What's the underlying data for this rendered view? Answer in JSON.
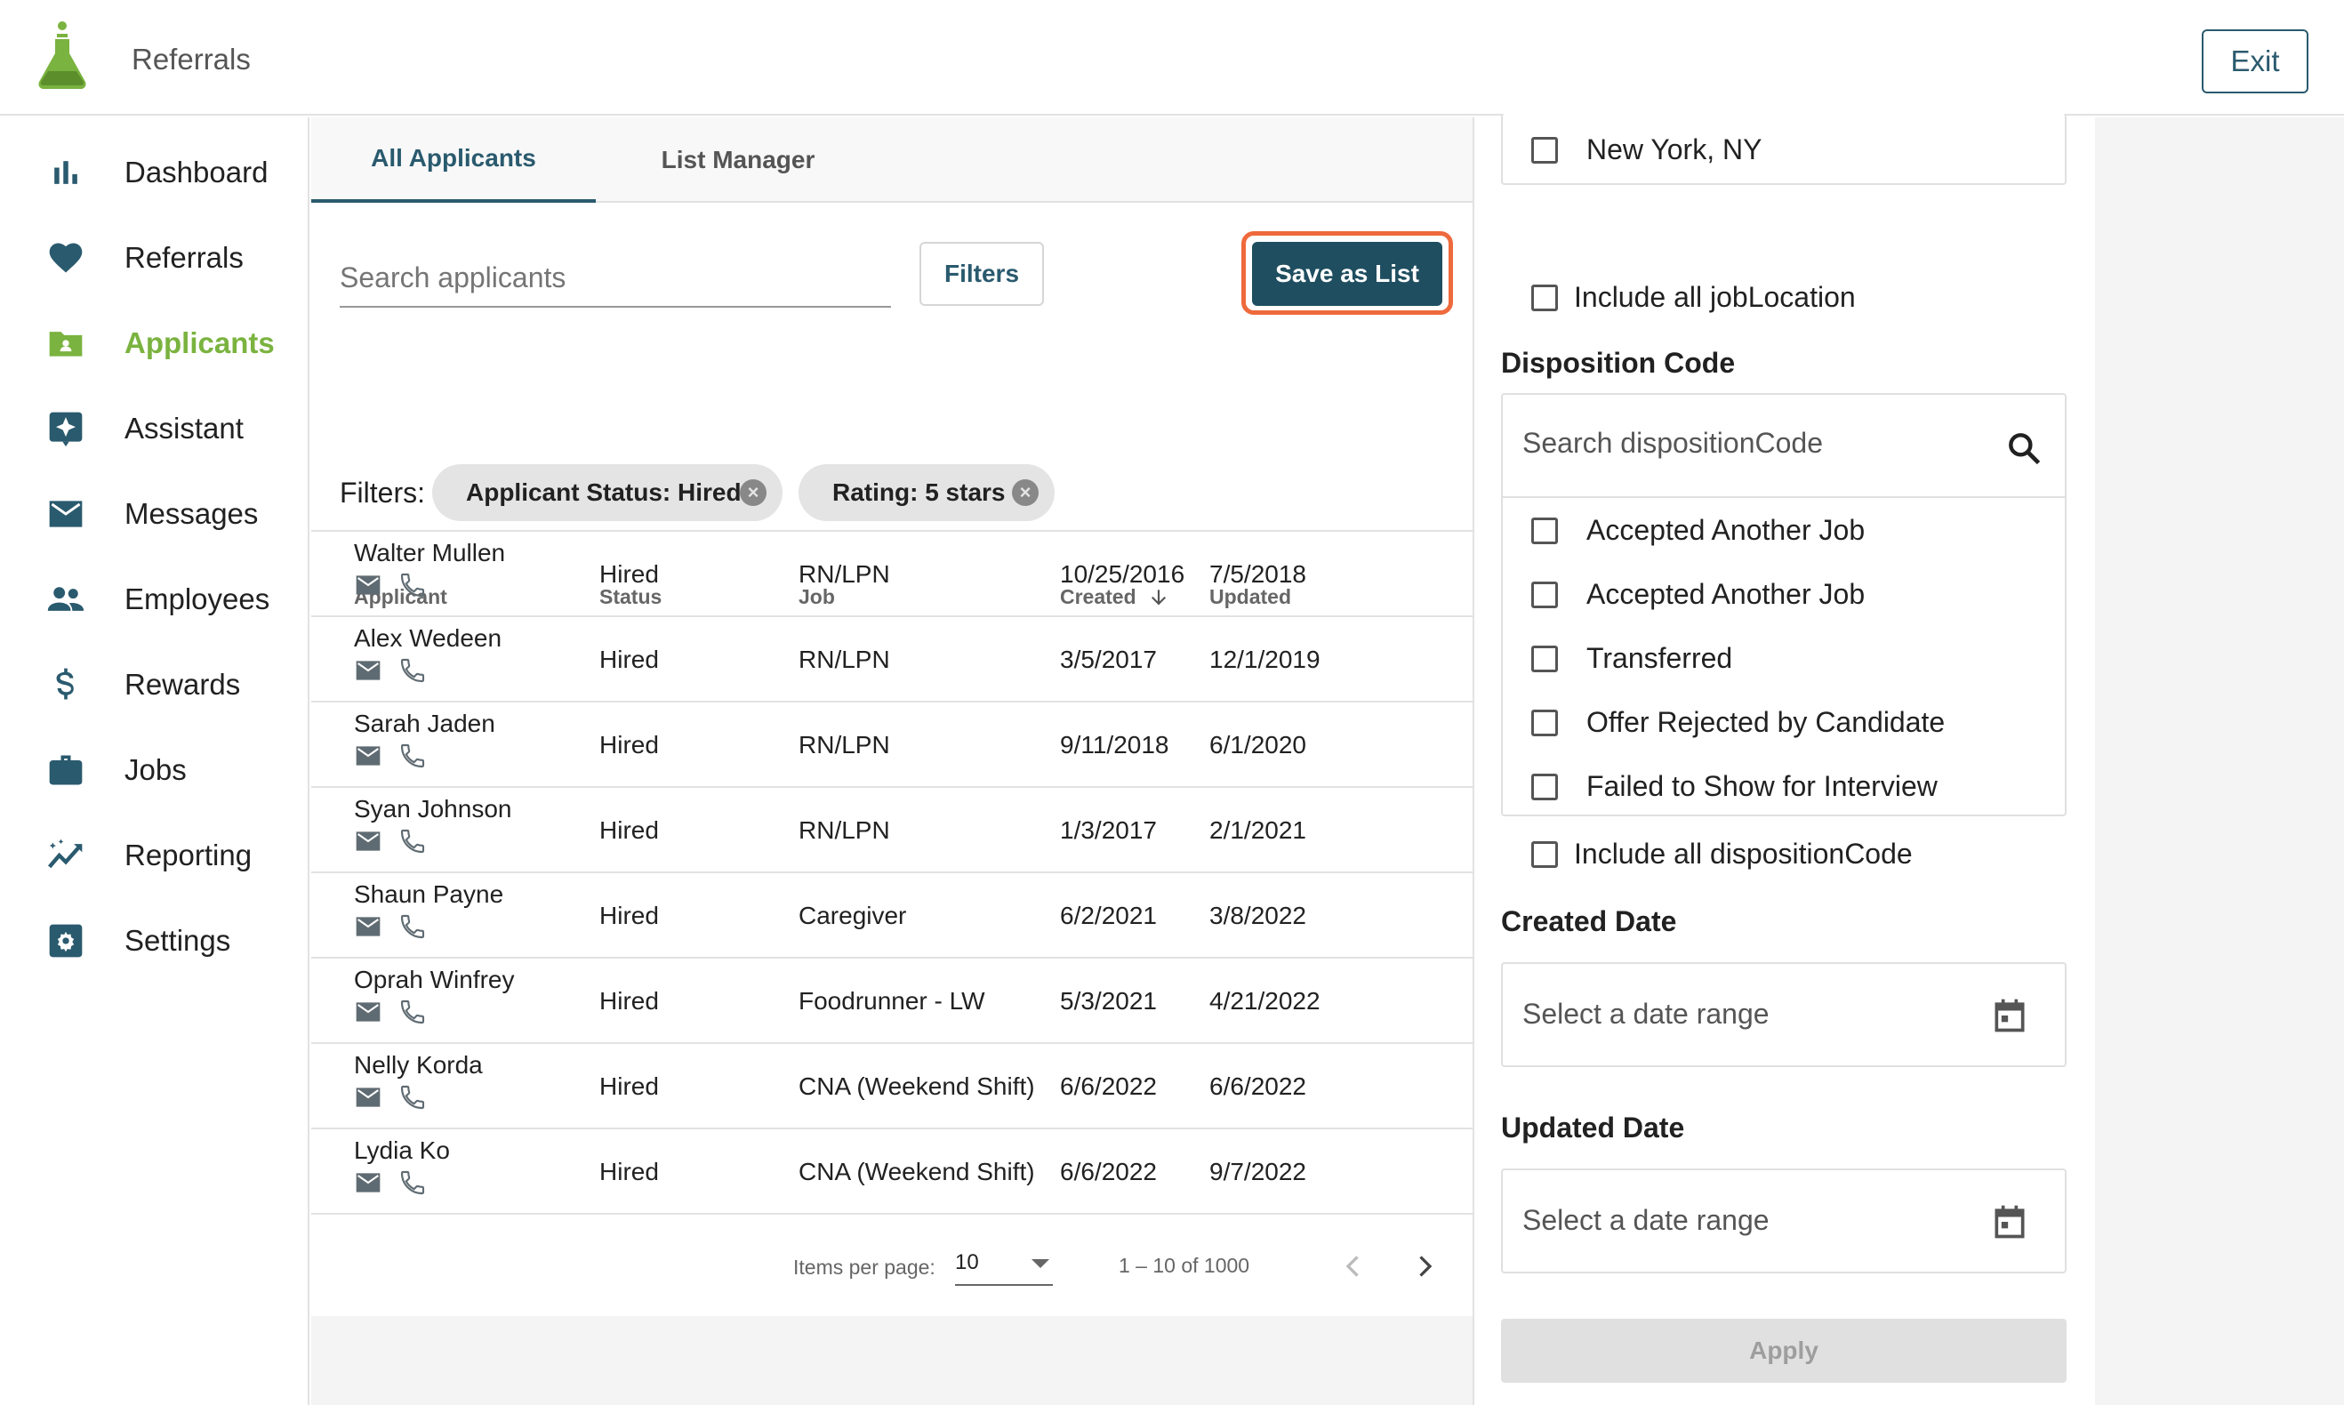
{
  "header": {
    "app_title": "Referrals",
    "exit_label": "Exit"
  },
  "sidebar": {
    "items": [
      {
        "label": "Dashboard",
        "icon": "bar-chart-icon"
      },
      {
        "label": "Referrals",
        "icon": "heart-icon"
      },
      {
        "label": "Applicants",
        "icon": "folder-user-icon",
        "active": true
      },
      {
        "label": "Assistant",
        "icon": "sparkle-icon"
      },
      {
        "label": "Messages",
        "icon": "mail-icon"
      },
      {
        "label": "Employees",
        "icon": "people-icon"
      },
      {
        "label": "Rewards",
        "icon": "dollar-icon"
      },
      {
        "label": "Jobs",
        "icon": "briefcase-icon"
      },
      {
        "label": "Reporting",
        "icon": "trend-icon"
      },
      {
        "label": "Settings",
        "icon": "gear-icon"
      }
    ]
  },
  "main": {
    "tabs": [
      {
        "label": "All Applicants",
        "active": true
      },
      {
        "label": "List Manager",
        "active": false
      }
    ],
    "search_placeholder": "Search applicants",
    "filters_button": "Filters",
    "save_button": "Save as List",
    "filters_label": "Filters:",
    "chips": [
      "Applicant Status: Hired",
      "Rating: 5 stars"
    ],
    "columns": [
      "Applicant",
      "Status",
      "Job",
      "Created",
      "Updated"
    ],
    "rows": [
      {
        "name": "Walter Mullen",
        "status": "Hired",
        "job": "RN/LPN",
        "created": "10/25/2016",
        "updated": "7/5/2018"
      },
      {
        "name": "Alex Wedeen",
        "status": "Hired",
        "job": "RN/LPN",
        "created": "3/5/2017",
        "updated": "12/1/2019"
      },
      {
        "name": "Sarah Jaden",
        "status": "Hired",
        "job": "RN/LPN",
        "created": "9/11/2018",
        "updated": "6/1/2020"
      },
      {
        "name": "Syan Johnson",
        "status": "Hired",
        "job": "RN/LPN",
        "created": "1/3/2017",
        "updated": "2/1/2021"
      },
      {
        "name": "Shaun Payne",
        "status": "Hired",
        "job": "Caregiver",
        "created": "6/2/2021",
        "updated": "3/8/2022"
      },
      {
        "name": "Oprah Winfrey",
        "status": "Hired",
        "job": "Foodrunner - LW",
        "created": "5/3/2021",
        "updated": "4/21/2022"
      },
      {
        "name": "Nelly Korda",
        "status": "Hired",
        "job": "CNA (Weekend Shift)",
        "created": "6/6/2022",
        "updated": "6/6/2022"
      },
      {
        "name": "Lydia Ko",
        "status": "Hired",
        "job": "CNA (Weekend Shift)",
        "created": "6/6/2022",
        "updated": "9/7/2022"
      }
    ],
    "paginator": {
      "items_label": "Items per page:",
      "page_size": "10",
      "range": "1 – 10 of 1000"
    }
  },
  "panel": {
    "location_option": "New York, NY",
    "include_location": "Include all jobLocation",
    "disposition_title": "Disposition Code",
    "disposition_search_placeholder": "Search dispositionCode",
    "disposition_options": [
      "Accepted Another Job",
      "Accepted Another Job",
      "Transferred",
      "Offer Rejected by Candidate",
      "Failed to Show for Interview"
    ],
    "include_disposition": "Include all dispositionCode",
    "created_title": "Created Date",
    "created_placeholder": "Select a date range",
    "updated_title": "Updated Date",
    "updated_placeholder": "Select a date range",
    "apply_label": "Apply"
  },
  "colors": {
    "brand_green": "#7ab33f",
    "primary_teal": "#1f4e60",
    "highlight_orange": "#ee6a3c"
  }
}
